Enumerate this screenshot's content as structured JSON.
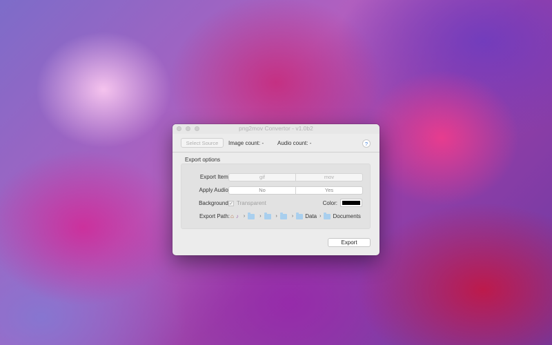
{
  "window": {
    "title": "png2mov Convertor - v1.0b2"
  },
  "toolbar": {
    "select_source_label": "Select Source",
    "image_count": "Image count: -",
    "audio_count": "Audio count: -",
    "help_label": "?"
  },
  "export_options": {
    "title": "Export options",
    "export_item": {
      "label": "Export Item:",
      "options": [
        "gif",
        "mov"
      ]
    },
    "apply_audio": {
      "label": "Apply Audio:",
      "options": [
        "No",
        "Yes"
      ]
    },
    "background": {
      "label": "Background:",
      "checkbox_label": "Transparent",
      "checked": true,
      "check_mark": "✓"
    },
    "color": {
      "label": "Color:",
      "value": "#000000"
    },
    "export_path": {
      "label": "Export Path:",
      "segments": [
        "",
        "",
        "",
        "",
        "Data",
        "Documents"
      ],
      "separator": "›"
    }
  },
  "actions": {
    "export_label": "Export"
  }
}
